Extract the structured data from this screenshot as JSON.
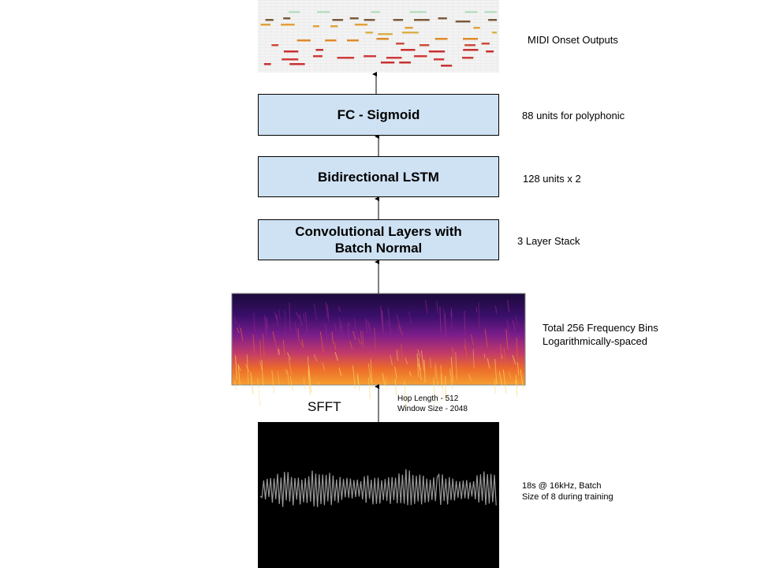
{
  "midi": {
    "label": "MIDI Onset Outputs"
  },
  "fc": {
    "title": "FC - Sigmoid",
    "note": "88 units for polyphonic"
  },
  "lstm": {
    "title": "Bidirectional LSTM",
    "note": "128 units x 2"
  },
  "conv": {
    "title_line1": "Convolutional Layers with",
    "title_line2": "Batch Normal",
    "note": "3 Layer Stack"
  },
  "spectrogram": {
    "note_line1": "Total 256 Frequency Bins",
    "note_line2": "Logarithmically-spaced"
  },
  "sfft": {
    "label": "SFFT",
    "note_line1": "Hop Length - 512",
    "note_line2": "Window Size - 2048"
  },
  "waveform": {
    "note_line1": "18s @ 16kHz, Batch",
    "note_line2": "Size of 8 during training"
  },
  "colors": {
    "box_fill": "#cfe2f3",
    "waveform_bg": "#000000",
    "waveform_line": "#9a9a9a"
  }
}
